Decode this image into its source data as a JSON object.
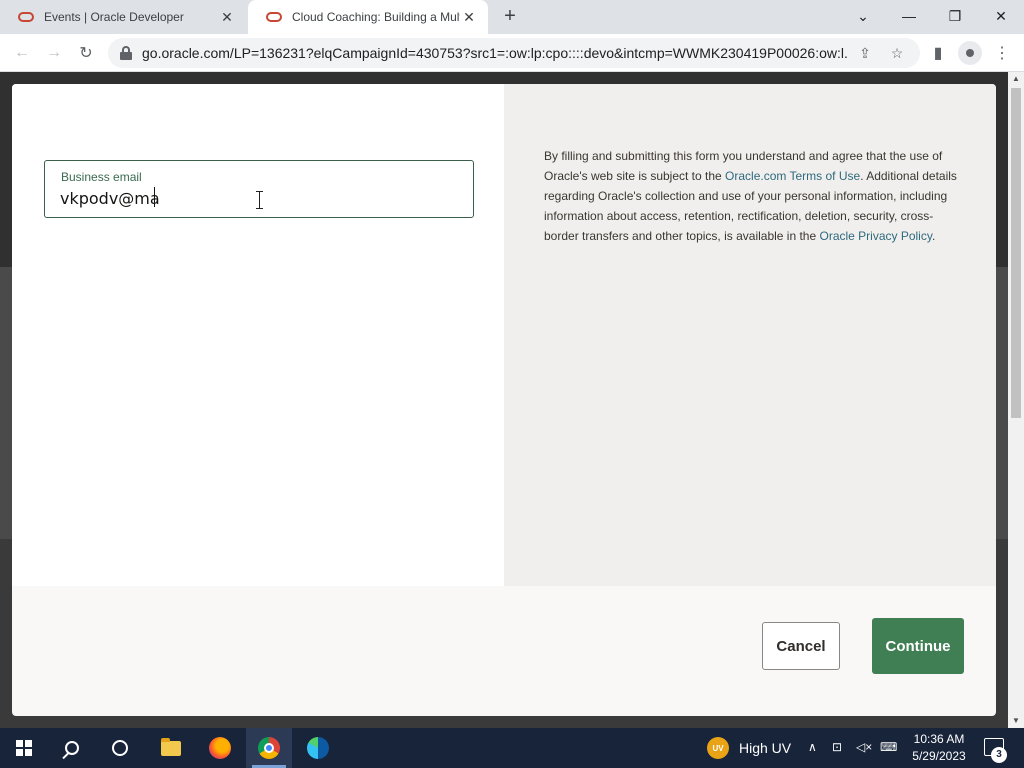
{
  "browser": {
    "tabs": [
      {
        "title": "Events | Oracle Developer",
        "active": false
      },
      {
        "title": "Cloud Coaching: Building a Multi",
        "active": true
      }
    ],
    "new_tab_symbol": "+",
    "url": "go.oracle.com/LP=136231?elqCampaignId=430753?src1=:ow:lp:cpo::::devo&intcmp=WWMK230419P00026:ow:l..."
  },
  "form": {
    "email_label": "Business email",
    "email_value": "vkpodv@ma",
    "legal": {
      "text_1": "By filling and submitting this form you understand and agree that the use of Oracle's web site is subject to the ",
      "terms_link": "Oracle.com Terms of Use",
      "text_2": ". Additional details regarding Oracle's collection and use of your personal information, including information about access, retention, rectification, deletion, security, cross-border transfers and other topics, is available in the ",
      "privacy_link": "Oracle Privacy Policy",
      "text_3": "."
    },
    "cancel_label": "Cancel",
    "continue_label": "Continue"
  },
  "taskbar": {
    "weather_badge": "UV",
    "weather_text": "High UV",
    "time": "10:36 AM",
    "date": "5/29/2023",
    "notification_count": "3"
  },
  "colors": {
    "accent_green": "#3f7f53",
    "link_teal": "#2d6a7d",
    "oracle_red": "#c74634"
  }
}
